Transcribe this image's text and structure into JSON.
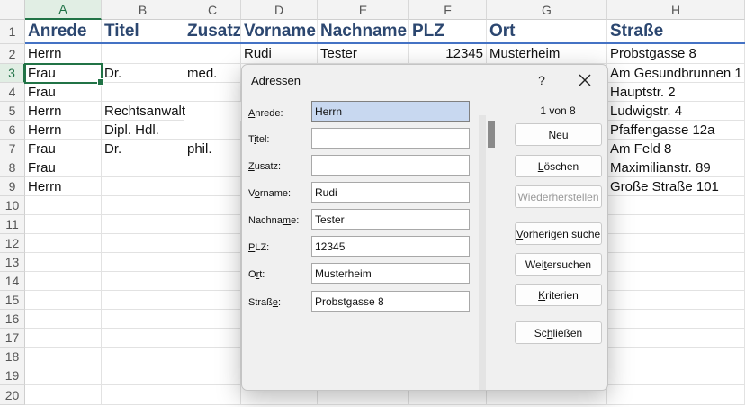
{
  "sheet": {
    "columns": [
      "A",
      "B",
      "C",
      "D",
      "E",
      "F",
      "G",
      "H"
    ],
    "rows": [
      "1",
      "2",
      "3",
      "4",
      "5",
      "6",
      "7",
      "8",
      "9",
      "10",
      "11",
      "12",
      "13",
      "14",
      "15",
      "16",
      "17",
      "18",
      "19",
      "20"
    ],
    "headers": [
      "Anrede",
      "Titel",
      "Zusatz",
      "Vorname",
      "Nachname",
      "PLZ",
      "Ort",
      "Straße"
    ],
    "data": [
      [
        "Herrn",
        "",
        "",
        "Rudi",
        "Tester",
        "12345",
        "Musterheim",
        "Probstgasse 8"
      ],
      [
        "Frau",
        "Dr.",
        "med.",
        "",
        "",
        "",
        "",
        "Am Gesundbrunnen 1"
      ],
      [
        "Frau",
        "",
        "",
        "",
        "",
        "",
        "",
        "Hauptstr. 2"
      ],
      [
        "Herrn",
        "Rechtsanwalt",
        "",
        "",
        "",
        "",
        "",
        "Ludwigstr. 4"
      ],
      [
        "Herrn",
        "Dipl. Hdl.",
        "",
        "",
        "",
        "",
        "",
        "Pfaffengasse 12a"
      ],
      [
        "Frau",
        "Dr.",
        "phil.",
        "",
        "",
        "",
        "",
        "Am Feld 8"
      ],
      [
        "Frau",
        "",
        "",
        "",
        "",
        "",
        "",
        "Maximilianstr. 89"
      ],
      [
        "Herrn",
        "",
        "",
        "",
        "",
        "",
        "",
        "Große Straße 101"
      ]
    ],
    "active_cell": "A3"
  },
  "dialog": {
    "title": "Adressen",
    "help": "?",
    "counter": "1 von 8",
    "fields": [
      {
        "label": "Anrede:",
        "value": "Herrn"
      },
      {
        "label": "Titel:",
        "value": ""
      },
      {
        "label": "Zusatz:",
        "value": ""
      },
      {
        "label": "Vorname:",
        "value": "Rudi"
      },
      {
        "label": "Nachname:",
        "value": "Tester"
      },
      {
        "label": "PLZ:",
        "value": "12345"
      },
      {
        "label": "Ort:",
        "value": "Musterheim"
      },
      {
        "label": "Straße:",
        "value": "Probstgasse 8"
      }
    ],
    "buttons": [
      {
        "label": "Neu",
        "enabled": true
      },
      {
        "label": "Löschen",
        "enabled": true
      },
      {
        "label": "Wiederherstellen",
        "enabled": false
      },
      {
        "label": "Vorherigen suche",
        "enabled": true
      },
      {
        "label": "Weitersuchen",
        "enabled": true
      },
      {
        "label": "Kriterien",
        "enabled": true
      },
      {
        "label": "Schließen",
        "enabled": true
      }
    ]
  },
  "colors": {
    "header_text": "#2c4770",
    "header_rule": "#4472c4",
    "selection_green": "#217346"
  },
  "icons": {
    "close": "close-icon"
  }
}
